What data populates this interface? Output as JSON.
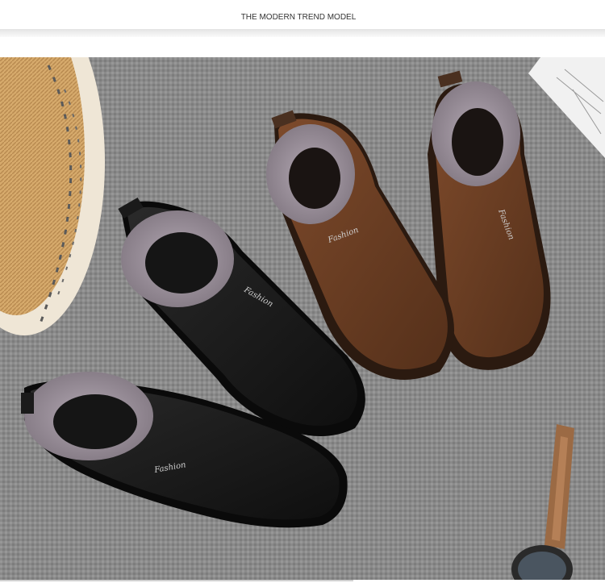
{
  "header": {
    "title": "THE MODERN TREND MODEL"
  },
  "photo": {
    "subject": "winter-fur-lined-slip-on-shoes",
    "colors": {
      "carpet": "#8d8d8d",
      "black_shoe": "#1c1c1c",
      "brown_shoe": "#6b3f24",
      "fur": "#9a8f9a",
      "basket": "#d9ae72"
    },
    "logo_text": "Fashion"
  }
}
